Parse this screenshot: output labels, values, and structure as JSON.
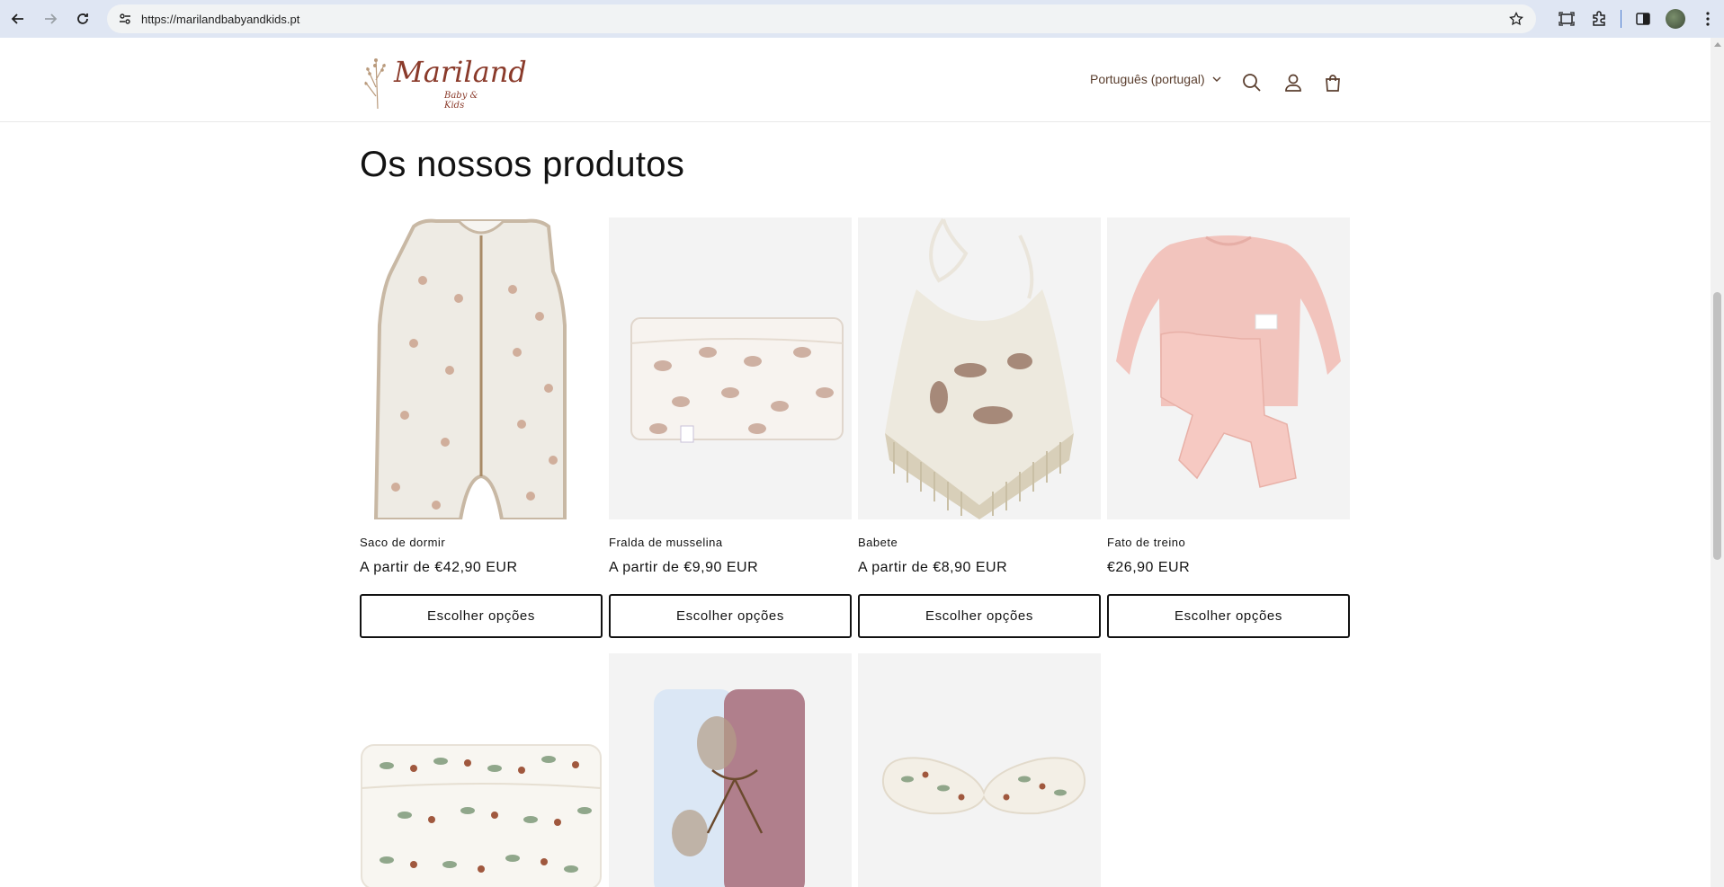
{
  "browser": {
    "url": "https://marilandbabyandkids.pt",
    "icons": [
      "back-icon",
      "forward-icon",
      "reload-icon",
      "site-info-icon",
      "star-icon",
      "screenshot-icon",
      "extensions-icon",
      "side-panel-icon",
      "profile-avatar",
      "menu-icon"
    ]
  },
  "header": {
    "logo_text": "Mariland",
    "logo_sub": "Baby & Kids",
    "language": "Português (portugal)",
    "accent_color": "#8a3a2a"
  },
  "section": {
    "title": "Os nossos produtos"
  },
  "products": [
    {
      "title": "Saco de dormir",
      "price": "A partir de €42,90 EUR",
      "button": "Escolher opções"
    },
    {
      "title": "Fralda de musselina",
      "price": "A partir de €9,90 EUR",
      "button": "Escolher opções"
    },
    {
      "title": "Babete",
      "price": "A partir de €8,90 EUR",
      "button": "Escolher opções"
    },
    {
      "title": "Fato de treino",
      "price": "€26,90 EUR",
      "button": "Escolher opções"
    }
  ]
}
